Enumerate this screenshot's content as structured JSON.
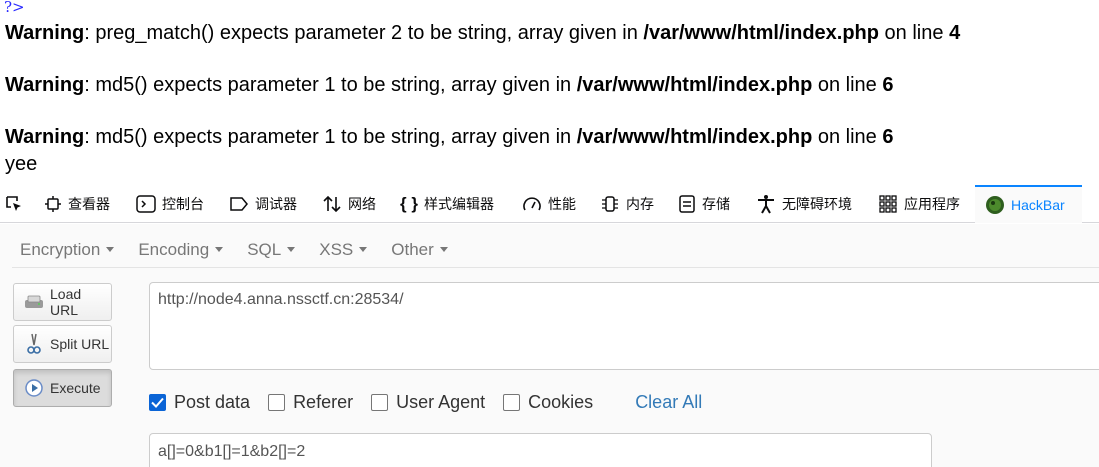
{
  "php_output": {
    "open_tag": "?>",
    "warnings": [
      {
        "label": "Warning",
        "message": ": preg_match() expects parameter 2 to be string, array given in ",
        "file": "/var/www/html/index.php",
        "on_line": " on line ",
        "line": "4"
      },
      {
        "label": "Warning",
        "message": ": md5() expects parameter 1 to be string, array given in ",
        "file": "/var/www/html/index.php",
        "on_line": " on line ",
        "line": "6"
      },
      {
        "label": "Warning",
        "message": ": md5() expects parameter 1 to be string, array given in ",
        "file": "/var/www/html/index.php",
        "on_line": " on line ",
        "line": "6"
      }
    ],
    "text": "yee"
  },
  "devtools": {
    "tabs": [
      {
        "label": "查看器",
        "icon": "inspector-icon"
      },
      {
        "label": "控制台",
        "icon": "console-icon"
      },
      {
        "label": "调试器",
        "icon": "debugger-icon"
      },
      {
        "label": "网络",
        "icon": "network-icon"
      },
      {
        "label": "样式编辑器",
        "icon": "style-editor-icon"
      },
      {
        "label": "性能",
        "icon": "performance-icon"
      },
      {
        "label": "内存",
        "icon": "memory-icon"
      },
      {
        "label": "存储",
        "icon": "storage-icon"
      },
      {
        "label": "无障碍环境",
        "icon": "accessibility-icon"
      },
      {
        "label": "应用程序",
        "icon": "application-icon"
      },
      {
        "label": "HackBar",
        "icon": "hackbar-icon"
      }
    ],
    "active_tab": "HackBar"
  },
  "hackbar": {
    "menu": [
      "Encryption",
      "Encoding",
      "SQL",
      "XSS",
      "Other"
    ],
    "buttons": {
      "load": "Load URL",
      "split": "Split URL",
      "execute": "Execute"
    },
    "url": "http://node4.anna.nssctf.cn:28534/",
    "options": [
      {
        "label": "Post data",
        "checked": true
      },
      {
        "label": "Referer",
        "checked": false
      },
      {
        "label": "User Agent",
        "checked": false
      },
      {
        "label": "Cookies",
        "checked": false
      }
    ],
    "clear_all": "Clear All",
    "post_body": "a[]=0&b1[]=1&b2[]=2"
  },
  "colors": {
    "accent": "#0a84ff",
    "link": "#337ab7",
    "php_tag": "#2a2aff",
    "checkbox": "#0a64d6"
  }
}
